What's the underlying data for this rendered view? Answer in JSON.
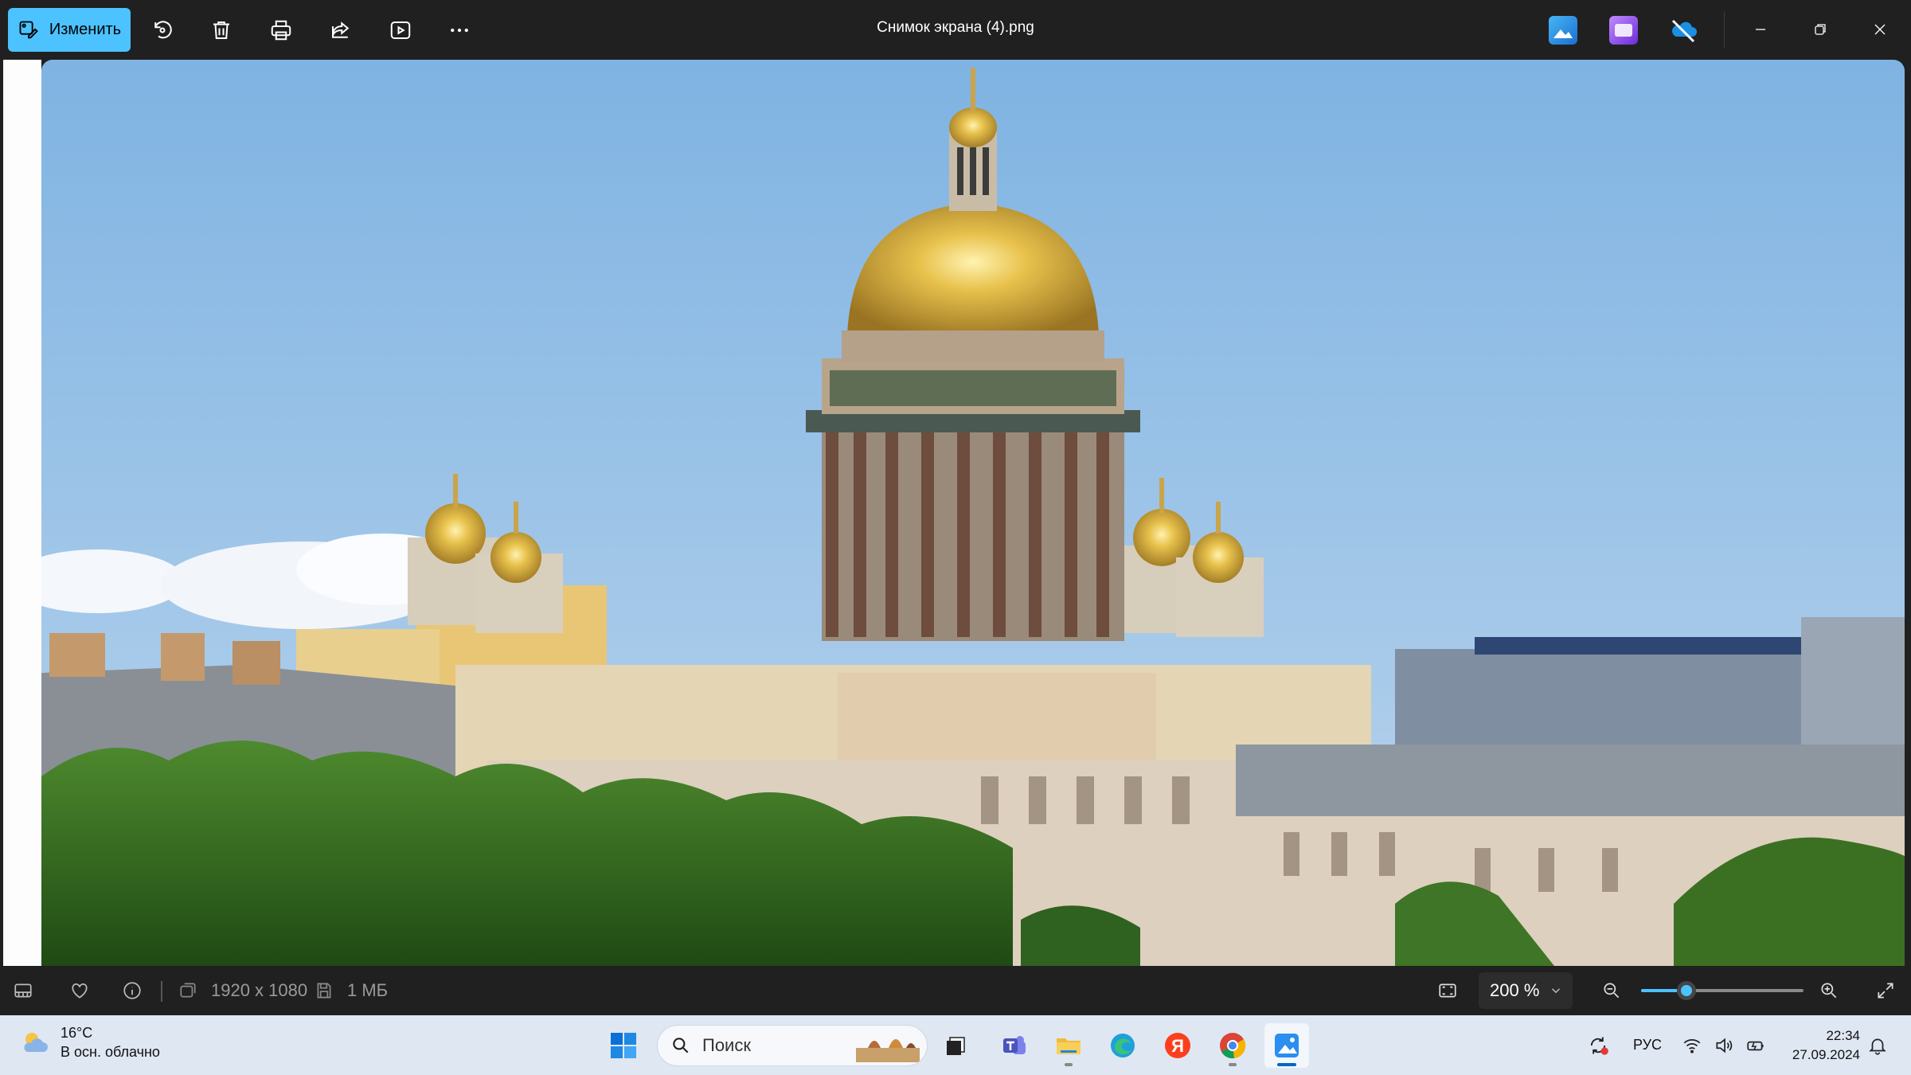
{
  "window": {
    "title": "Снимок экрана (4).png",
    "edit_label": "Изменить"
  },
  "toolbar": {
    "icons": [
      "rotate-icon",
      "delete-icon",
      "print-icon",
      "share-icon",
      "slideshow-icon",
      "more-icon"
    ],
    "apps": [
      "photos-icon",
      "clipchamp-icon",
      "onedrive-icon"
    ]
  },
  "statusbar": {
    "dimensions": "1920 x 1080",
    "file_size": "1 МБ",
    "zoom_label": "200 %",
    "zoom_level_fraction": 0.28
  },
  "taskbar": {
    "weather_temp": "16°C",
    "weather_desc": "В осн. облачно",
    "search_placeholder": "Поиск",
    "language": "РУС",
    "time": "22:34",
    "date": "27.09.2024"
  },
  "colors": {
    "accent": "#4cc2ff",
    "toolbar_bg": "#202020",
    "taskbar_bg": "#dfe7f3"
  }
}
